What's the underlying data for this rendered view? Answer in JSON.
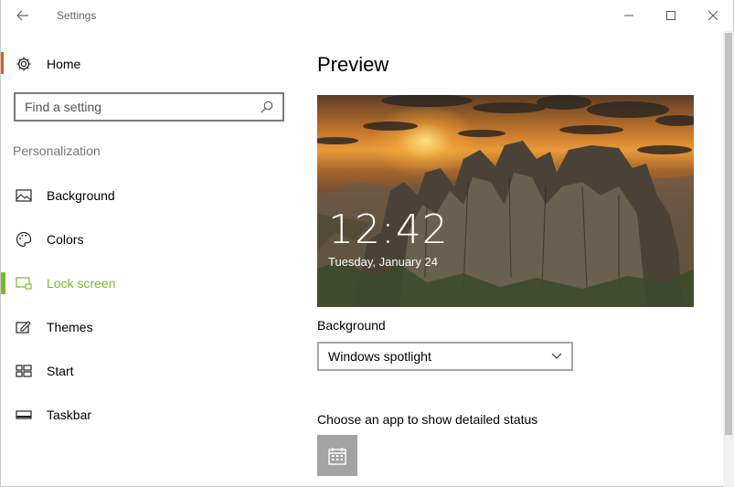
{
  "window": {
    "title": "Settings"
  },
  "nav": {
    "home_label": "Home",
    "search": {
      "placeholder": "Find a setting"
    },
    "section_label": "Personalization",
    "items": [
      {
        "label": "Background",
        "icon": "picture-icon",
        "active": false
      },
      {
        "label": "Colors",
        "icon": "palette-icon",
        "active": false
      },
      {
        "label": "Lock screen",
        "icon": "lock-screen-icon",
        "active": true
      },
      {
        "label": "Themes",
        "icon": "themes-icon",
        "active": false
      },
      {
        "label": "Start",
        "icon": "start-icon",
        "active": false
      },
      {
        "label": "Taskbar",
        "icon": "taskbar-icon",
        "active": false
      }
    ]
  },
  "content": {
    "title": "Preview",
    "preview": {
      "time": "12:42",
      "date": "Tuesday, January 24"
    },
    "background_label": "Background",
    "background_value": "Windows spotlight",
    "status_label": "Choose an app to show detailed status",
    "status_app_icon": "calendar-icon"
  },
  "colors": {
    "accent": "#7bb72f",
    "home_strip": "#e05a1f",
    "app_tile": "#a3a3a3"
  }
}
